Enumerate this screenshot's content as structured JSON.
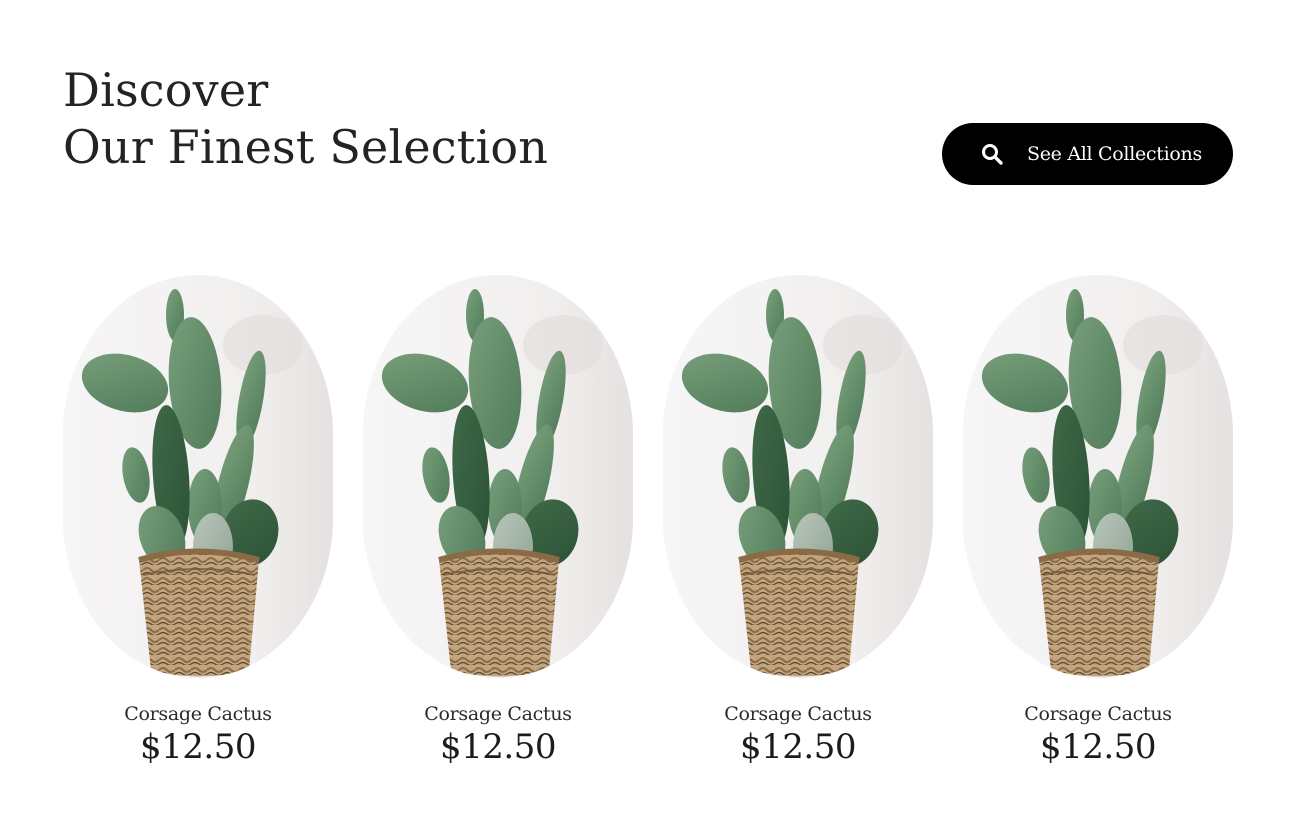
{
  "header": {
    "line1": "Discover",
    "line2": "Our Finest Selection"
  },
  "cta": {
    "label": "See All Collections",
    "icon": "search-icon"
  },
  "products": [
    {
      "name": "Corsage Cactus",
      "price": "$12.50",
      "image": "cactus-in-woven-basket"
    },
    {
      "name": "Corsage Cactus",
      "price": "$12.50",
      "image": "cactus-in-woven-basket"
    },
    {
      "name": "Corsage Cactus",
      "price": "$12.50",
      "image": "cactus-in-woven-basket"
    },
    {
      "name": "Corsage Cactus",
      "price": "$12.50",
      "image": "cactus-in-woven-basket"
    }
  ],
  "colors": {
    "background": "#ffffff",
    "text": "#232323",
    "button_bg": "#000000",
    "button_text": "#ffffff",
    "cactus": "#5f8a66",
    "basket": "#b89a72"
  }
}
